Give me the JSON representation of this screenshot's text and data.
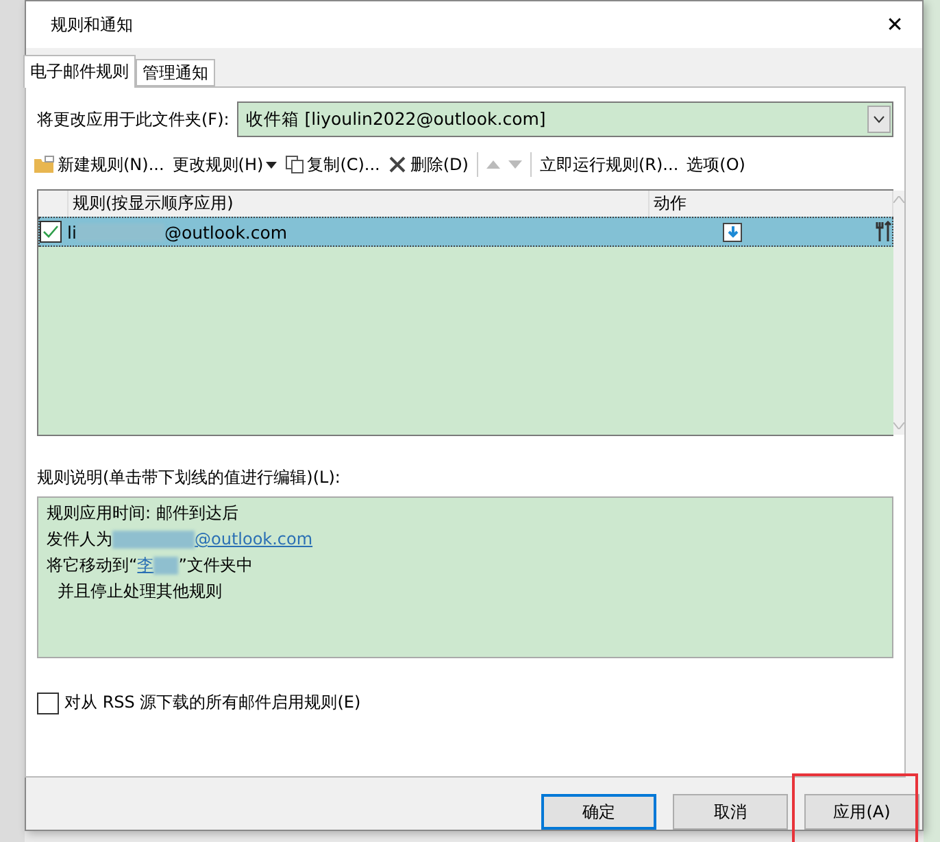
{
  "window": {
    "title": "规则和通知",
    "close": "✕"
  },
  "tabs": [
    {
      "label": "电子邮件规则",
      "selected": true
    },
    {
      "label": "管理通知",
      "selected": false
    }
  ],
  "folder": {
    "label": "将更改应用于此文件夹(F):",
    "value": "收件箱 [liyoulin2022@outlook.com]"
  },
  "toolbar": [
    {
      "kind": "new",
      "label": "新建规则(N)..."
    },
    {
      "kind": "change",
      "label": "更改规则(H)"
    },
    {
      "kind": "copy",
      "label": "复制(C)..."
    },
    {
      "kind": "delete",
      "label": "删除(D)"
    },
    {
      "kind": "up"
    },
    {
      "kind": "down"
    },
    {
      "kind": "run",
      "label": "立即运行规则(R)..."
    },
    {
      "kind": "options",
      "label": "选项(O)"
    }
  ],
  "table": {
    "columns": [
      "规则(按显示顺序应用)",
      "动作"
    ],
    "rows": [
      {
        "name_prefix": "li",
        "name_suffix": "@outlook.com",
        "checked": true,
        "selected": true
      }
    ]
  },
  "description": {
    "label": "规则说明(单击带下划线的值进行编辑)(L):",
    "lines": [
      {
        "kind": "plain",
        "text": "规则应用时间: 邮件到达后"
      },
      {
        "kind": "sender",
        "text": "发件人为 ",
        "link": "@outlook.com"
      },
      {
        "kind": "move",
        "text": "将它移动到“",
        "link": "李",
        "after": "”文件夹中"
      },
      {
        "kind": "indent",
        "text": "并且停止处理其他规则"
      }
    ]
  },
  "rss": {
    "label": "对从 RSS 源下载的所有邮件启用规则(E)",
    "checked": false
  },
  "buttons": [
    {
      "label": "确定",
      "default": true,
      "highlighted": false
    },
    {
      "label": "取消",
      "default": false,
      "highlighted": false
    },
    {
      "label": "应用(A)",
      "default": false,
      "highlighted": true
    }
  ]
}
